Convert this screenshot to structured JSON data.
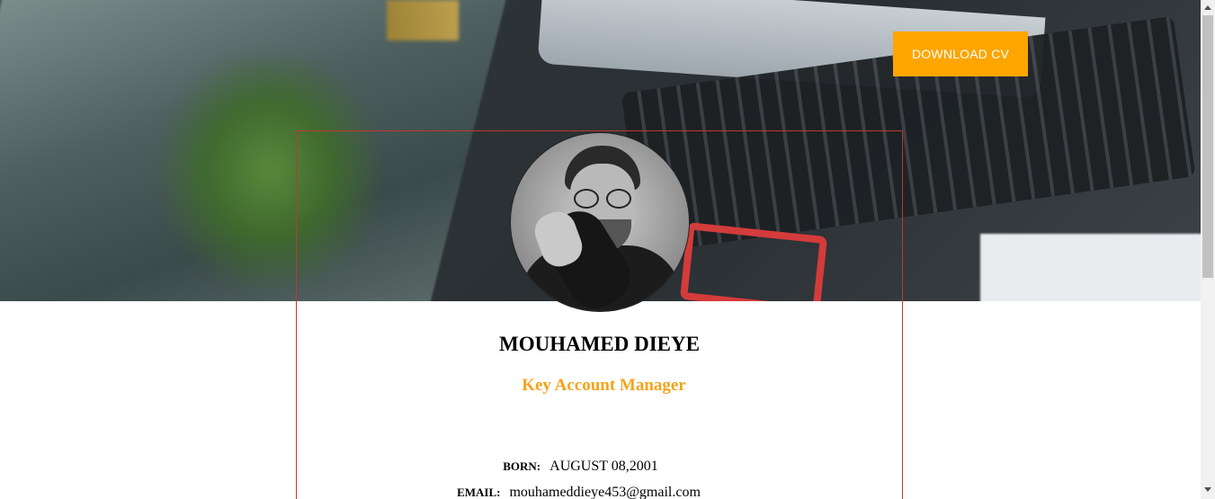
{
  "hero": {
    "image_description_icon": "desk-photo",
    "download_label": "DOWNLOAD CV"
  },
  "profile": {
    "name": "MOUHAMED DIEYE",
    "role": "Key Account Manager",
    "born_label": "BORN:",
    "born_value": "AUGUST 08,2001",
    "email_label": "EMAIL:",
    "email_value": "mouhameddieye453@gmail.com"
  },
  "colors": {
    "accent": "#ffa500",
    "role_text": "#f5a31a",
    "card_border": "#c0392b"
  }
}
